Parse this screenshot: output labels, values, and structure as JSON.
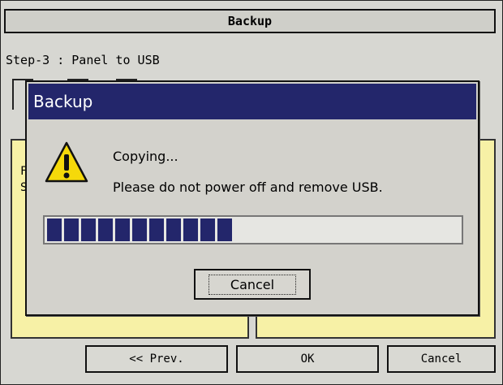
{
  "screen": {
    "title": "Backup",
    "step_label": "Step-3 : Panel to USB",
    "panel_fragment_1": "F",
    "panel_fragment_2": "S"
  },
  "dialog": {
    "title": "Backup",
    "icon": "warning-icon",
    "message_line1": "Copying...",
    "message_line2": "Please do not power off and remove USB.",
    "progress_segments": 11,
    "progress_fraction": 0.5,
    "cancel_label": "Cancel"
  },
  "buttons": {
    "prev_label": "<< Prev.",
    "ok_label": "OK",
    "cancel_label": "Cancel"
  },
  "colors": {
    "dialog_title_bg": "#23266b",
    "progress_fill": "#23266b",
    "panel_bg": "#f7f1a6",
    "screen_bg": "#d7d7d2"
  }
}
